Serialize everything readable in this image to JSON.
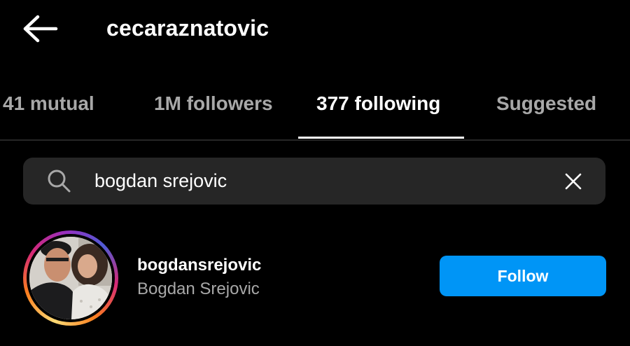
{
  "header": {
    "title": "cecaraznatovic",
    "back_icon": "arrow-left-icon"
  },
  "tabs": [
    {
      "label": "41 mutual",
      "active": false
    },
    {
      "label": "1M followers",
      "active": false
    },
    {
      "label": "377 following",
      "active": true
    },
    {
      "label": "Suggested",
      "active": false
    }
  ],
  "search": {
    "value": "bogdan srejovic",
    "search_icon": "search-icon",
    "clear_icon": "close-icon"
  },
  "results": [
    {
      "username": "bogdansrejovic",
      "full_name": "Bogdan Srejovic",
      "button_label": "Follow",
      "has_story_ring": true
    }
  ],
  "colors": {
    "background": "#000000",
    "primary_text": "#ffffff",
    "secondary_text": "#a8a8a8",
    "search_background": "#262626",
    "follow_button": "#0095f6"
  }
}
